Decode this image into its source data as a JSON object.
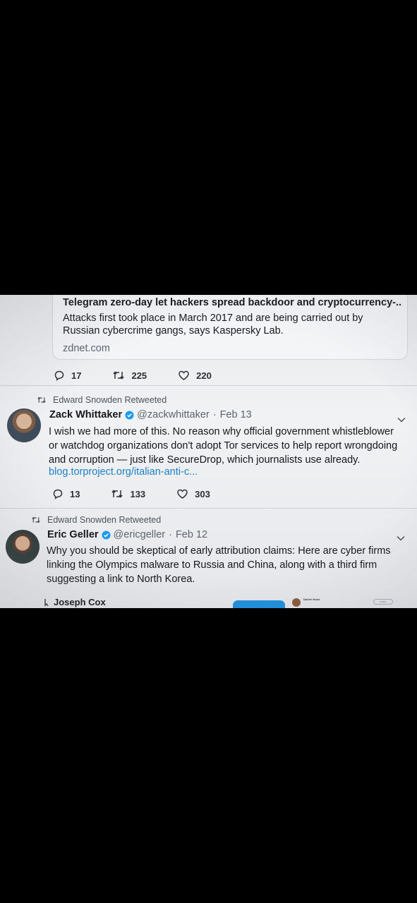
{
  "card": {
    "title": "Telegram zero-day let hackers spread backdoor and cryptocurrency-...",
    "description": "Attacks first took place in March 2017 and are being carried out by Russian cybercrime gangs, says Kaspersky Lab.",
    "domain": "zdnet.com"
  },
  "tweet0": {
    "replies": "17",
    "retweets": "225",
    "likes": "220"
  },
  "tweet1": {
    "retweeted_by": "Edward Snowden Retweeted",
    "name": "Zack Whittaker",
    "handle": "@zackwhittaker",
    "date": "Feb 13",
    "text": "I wish we had more of this. No reason why official government whistleblower or watchdog organizations don't adopt Tor services to help report wrongdoing and corruption — just like SecureDrop, which journalists use already.",
    "link": "blog.torproject.org/italian-anti-c...",
    "replies": "13",
    "retweets": "133",
    "likes": "303"
  },
  "tweet2": {
    "retweeted_by": "Edward Snowden Retweeted",
    "name": "Eric Geller",
    "handle": "@ericgeller",
    "date": "Feb 12",
    "text": "Why you should be skeptical of early attribution claims: Here are cyber firms linking the Olympics malware to Russia and China, along with a third firm suggesting a link to North Korea.",
    "embed_author": "Joseph Cox",
    "embed_mini_name": "Darien Huss",
    "embed_mini_follow": "Follow"
  },
  "icons": {
    "reply": "reply-icon",
    "retweet": "retweet-icon",
    "like": "heart-icon",
    "verified": "verified-badge-icon",
    "more": "chevron-down-icon"
  },
  "colors": {
    "link": "#1b7fc9",
    "verified": "#1d9bf0",
    "text": "#14171a",
    "muted": "#5b6670"
  }
}
